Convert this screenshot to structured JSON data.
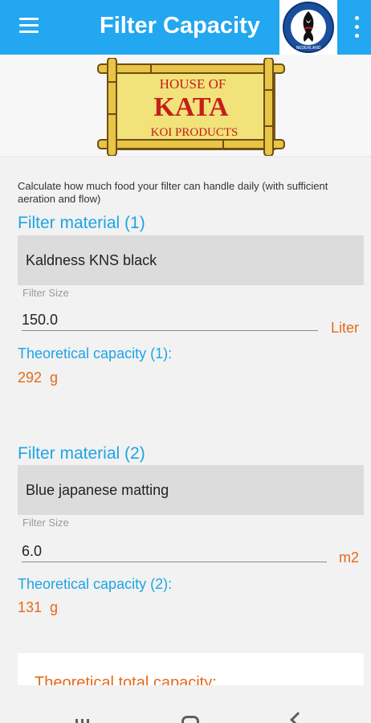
{
  "appbar": {
    "title": "Filter Capacity",
    "menu_icon": "hamburger-menu-icon",
    "more_icon": "more-vert-icon",
    "logo_text": "NEDERLAND",
    "accent": "#22a7f0"
  },
  "banner": {
    "line1": "HOUSE OF",
    "line2": "KATA",
    "line3": "KOI PRODUCTS"
  },
  "description": "Calculate how much food your filter can handle daily (with sufficient aeration and flow)",
  "filter1": {
    "title": "Filter material (1)",
    "material": "Kaldness KNS black",
    "size_label": "Filter Size",
    "size_value": "150.0",
    "unit": "Liter",
    "capacity_label": "Theoretical capacity (1):",
    "capacity_value": "292  g"
  },
  "filter2": {
    "title": "Filter material (2)",
    "material": "Blue japanese matting",
    "size_label": "Filter Size",
    "size_value": "6.0",
    "unit": "m2",
    "capacity_label": "Theoretical capacity (2):",
    "capacity_value": "131  g"
  },
  "total": {
    "title": "Theoretical total capacity:"
  },
  "navbar": {
    "recents_icon": "recents-icon",
    "home_icon": "home-icon",
    "back_icon": "back-icon"
  },
  "colors": {
    "blue": "#1da4e6",
    "orange": "#e56a1a",
    "select_bg": "#dcdcdc"
  }
}
